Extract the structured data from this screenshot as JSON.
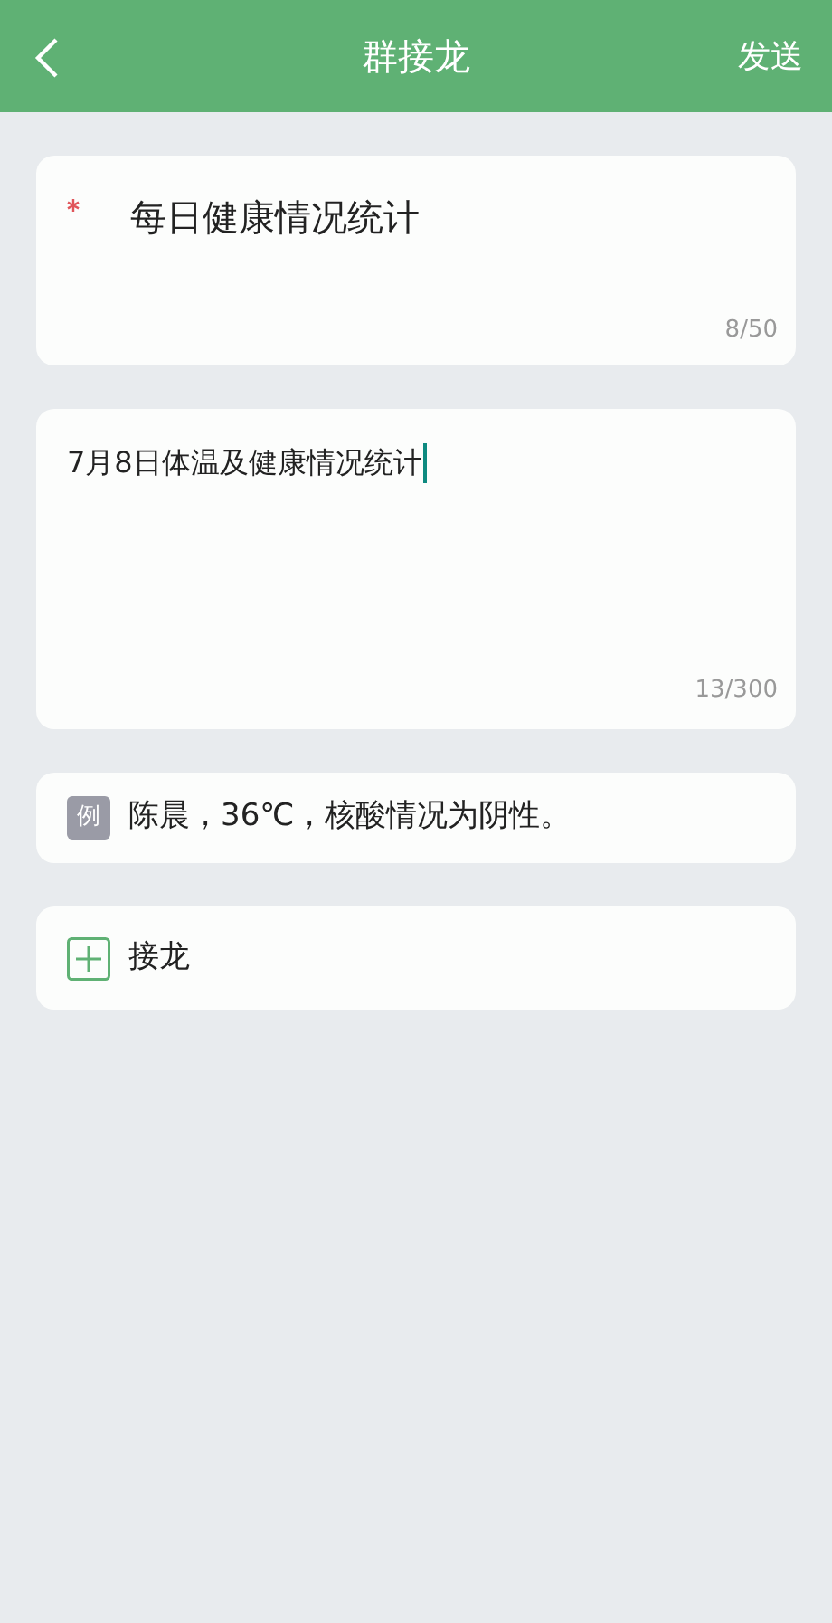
{
  "header": {
    "title": "群接龙",
    "action": "发送"
  },
  "title_field": {
    "required": true,
    "value": "每日健康情况统计",
    "counter": "8/50"
  },
  "description_field": {
    "value": "7月8日体温及健康情况统计",
    "counter": "13/300",
    "focused": true
  },
  "example": {
    "badge": "例",
    "text": "陈晨，36℃，核酸情况为阴性。"
  },
  "add_entry": {
    "label": "接龙"
  }
}
